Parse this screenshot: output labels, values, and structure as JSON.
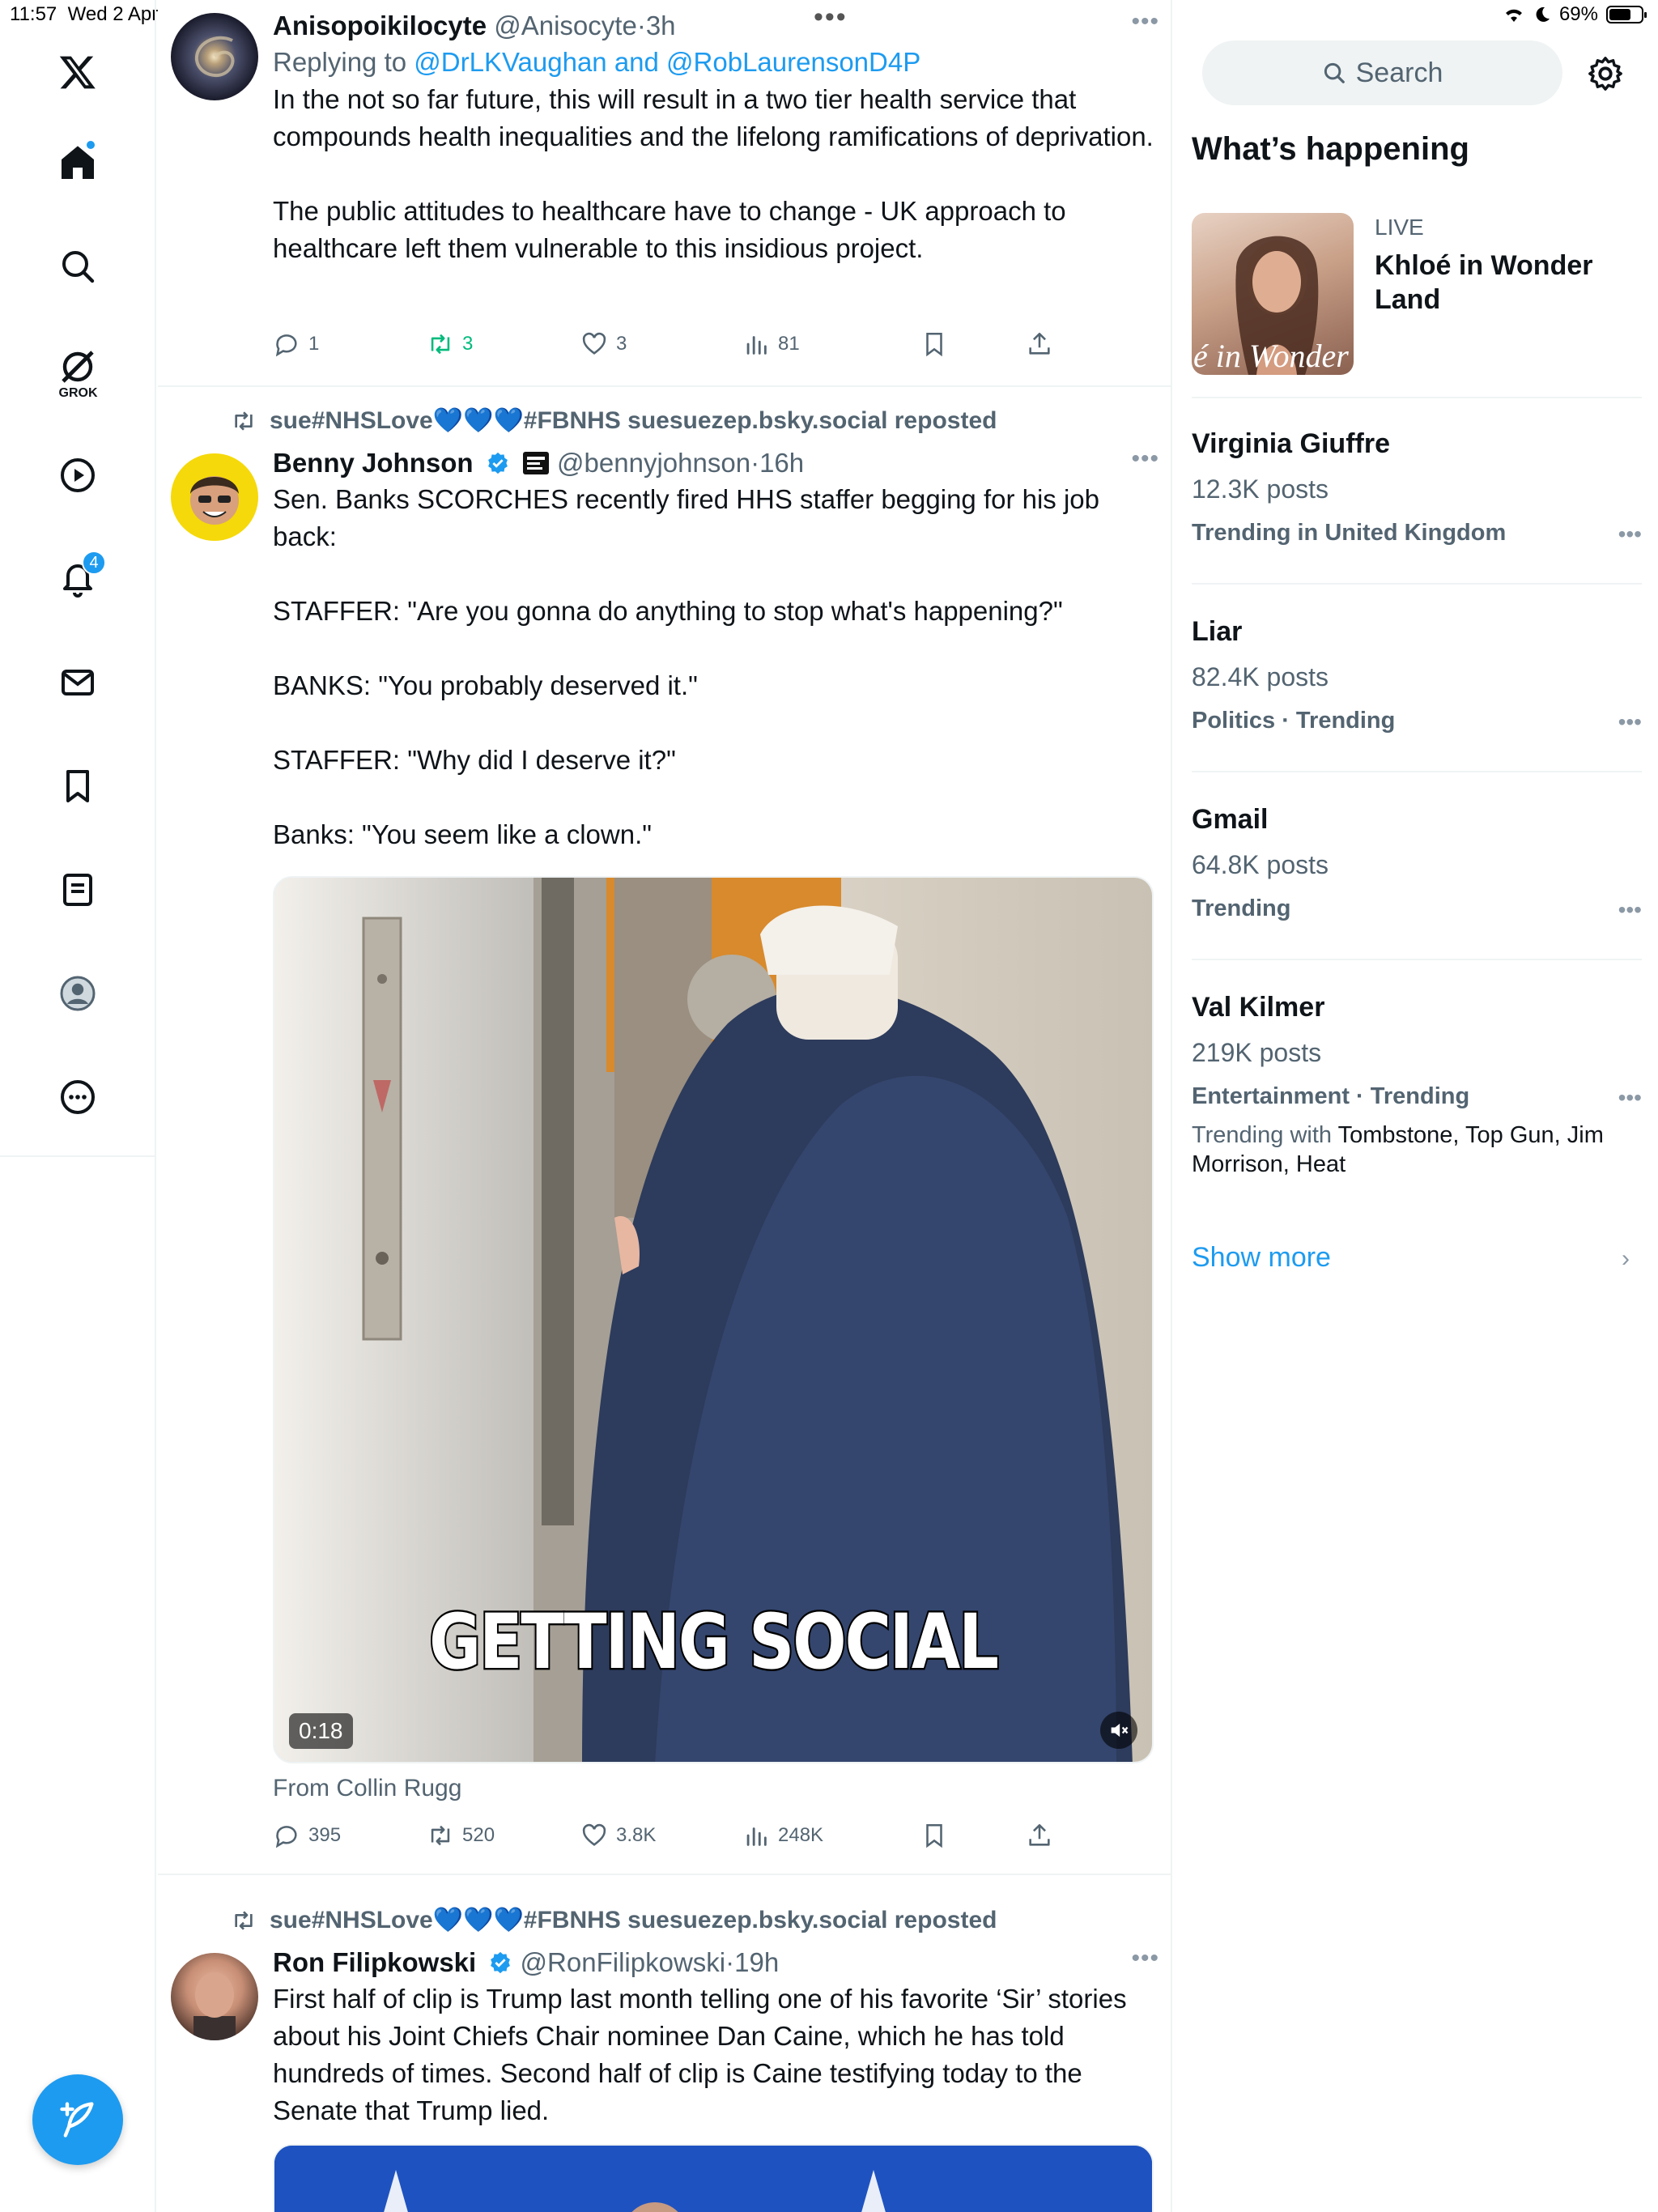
{
  "status_bar": {
    "time": "11:57",
    "date": "Wed 2 Apr",
    "battery": "69%",
    "battery_level": 0.69
  },
  "nav": {
    "items": [
      {
        "name": "x-logo",
        "icon": "x-logo-icon"
      },
      {
        "name": "home",
        "icon": "home-icon",
        "dot": true
      },
      {
        "name": "explore",
        "icon": "search-icon"
      },
      {
        "name": "grok",
        "icon": "grok-icon",
        "label": "GROK"
      },
      {
        "name": "video",
        "icon": "play-icon"
      },
      {
        "name": "notifications",
        "icon": "bell-icon",
        "badge": "4"
      },
      {
        "name": "messages",
        "icon": "mail-icon"
      },
      {
        "name": "bookmarks",
        "icon": "bookmark-icon"
      },
      {
        "name": "lists",
        "icon": "list-icon"
      },
      {
        "name": "profile",
        "icon": "profile-icon"
      },
      {
        "name": "more",
        "icon": "more-icon"
      }
    ]
  },
  "feed": {
    "tweets": [
      {
        "name": "Anisopoikilocyte",
        "handle": "@Anisocyte",
        "time": "3h",
        "replying_prefix": "Replying to",
        "replying_to": "@DrLKVaughan and @RobLaurensonD4P",
        "text": "In the not so far future, this will result in a two tier health service that compounds health inequalities and the lifelong ramifications of deprivation.\n\nThe public attitudes to healthcare have to change - UK approach to healthcare left them vulnerable to this insidious project.",
        "replies": "1",
        "reposts": "3",
        "likes": "3",
        "views": "81"
      },
      {
        "reposted_by": "sue#NHSLove💙💙💙#FBNHS suesuezep.bsky.social reposted",
        "name": "Benny Johnson",
        "handle": "@bennyjohnson",
        "time": "16h",
        "text": "Sen. Banks SCORCHES recently fired HHS staffer begging for his job back:\n\nSTAFFER: \"Are you gonna do anything to stop what's happening?\"\n\nBANKS: \"You probably deserved it.\"\n\nSTAFFER: \"Why did I deserve it?\"\n\nBanks: \"You seem like a clown.\"",
        "video_caption": "GETTING SOCIAL",
        "video_duration": "0:18",
        "from": "From Collin Rugg",
        "replies": "395",
        "reposts": "520",
        "likes": "3.8K",
        "views": "248K"
      },
      {
        "reposted_by": "sue#NHSLove💙💙💙#FBNHS suesuezep.bsky.social reposted",
        "name": "Ron Filipkowski",
        "handle": "@RonFilipkowski",
        "time": "19h",
        "text": "First half of clip is Trump last month telling one of his favorite ‘Sir’ stories about his Joint Chiefs Chair nominee Dan Caine, which he has told hundreds of times. Second half of clip is Caine testifying today to the Senate that Trump lied."
      }
    ]
  },
  "sidebar": {
    "search_placeholder": "Search",
    "heading": "What’s happening",
    "live": {
      "label": "LIVE",
      "title": "Khloé in Wonder Land",
      "image_text": "é in Wonder L"
    },
    "trends": [
      {
        "title": "Virginia Giuffre",
        "posts": "12.3K posts",
        "meta": "Trending in United Kingdom"
      },
      {
        "title": "Liar",
        "posts": "82.4K posts",
        "meta": "Politics · Trending"
      },
      {
        "title": "Gmail",
        "posts": "64.8K posts",
        "meta": "Trending"
      },
      {
        "title": "Val Kilmer",
        "posts": "219K posts",
        "meta": "Entertainment · Trending",
        "with_prefix": "Trending with",
        "with": "Tombstone, Top Gun, Jim Morrison, Heat"
      }
    ],
    "show_more": "Show more"
  },
  "colors": {
    "accent": "#1d9bf0",
    "repost_green": "#00ba7c",
    "muted": "#536471"
  }
}
